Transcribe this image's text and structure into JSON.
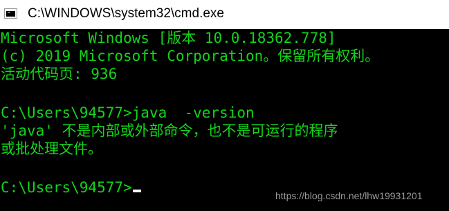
{
  "window": {
    "title": "C:\\WINDOWS\\system32\\cmd.exe",
    "icon": "cmd-console-icon"
  },
  "console": {
    "text_color": "#13d41a",
    "background": "#000000",
    "lines": [
      "Microsoft Windows [版本 10.0.18362.778]",
      "(c) 2019 Microsoft Corporation。保留所有权利。",
      "活动代码页: 936",
      "",
      "C:\\Users\\94577>java  -version",
      "'java' 不是内部或外部命令，也不是可运行的程序",
      "或批处理文件。",
      "",
      "C:\\Users\\94577>"
    ]
  },
  "watermark": {
    "text": "https://blog.csdn.net/lhw19931201"
  }
}
